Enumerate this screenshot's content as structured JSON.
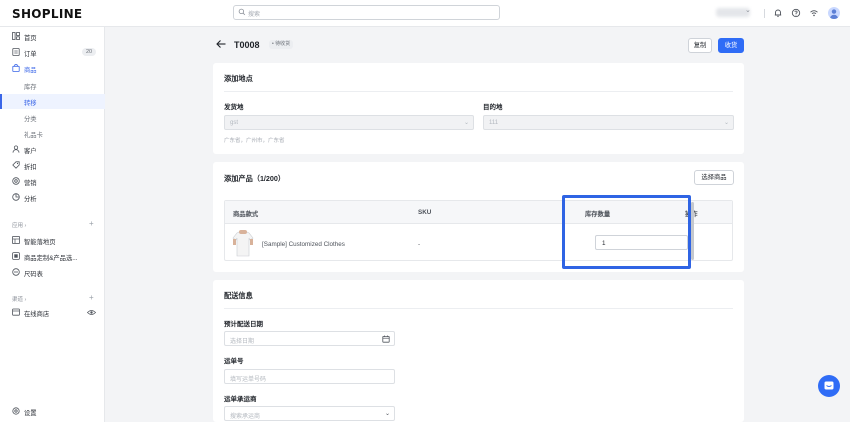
{
  "topbar": {
    "logo": "SHOPLINE",
    "search_placeholder": "搜索"
  },
  "sidebar": {
    "items": [
      {
        "label": "首页"
      },
      {
        "label": "订单",
        "badge": "20"
      },
      {
        "label": "商品"
      },
      {
        "label": "库存"
      },
      {
        "label": "转移"
      },
      {
        "label": "分类"
      },
      {
        "label": "礼品卡"
      },
      {
        "label": "客户"
      },
      {
        "label": "折扣"
      },
      {
        "label": "营销"
      },
      {
        "label": "分析"
      }
    ],
    "apps_section": "应用",
    "apps": [
      {
        "label": "智能落地页"
      },
      {
        "label": "商品定制&产品选..."
      },
      {
        "label": "尺码表"
      }
    ],
    "channels_section": "渠道",
    "channels": [
      {
        "label": "在线商店"
      }
    ],
    "settings_label": "设置"
  },
  "header": {
    "title": "T0008",
    "status": "• 待收货",
    "copy_button": "复制",
    "receive_button": "收货"
  },
  "location_card": {
    "title": "添加地点",
    "origin_label": "发货地",
    "origin_value": "gst",
    "origin_hint": "广东省，广州市，广东省",
    "destination_label": "目的地",
    "destination_value": "111"
  },
  "products_card": {
    "title": "添加产品（1/200）",
    "choose_button": "选择商品",
    "columns": [
      "商品款式",
      "SKU",
      "库存数量",
      "操作"
    ],
    "rows": [
      {
        "name": "[Sample] Customized Clothes",
        "sku": "-",
        "qty": "1"
      }
    ]
  },
  "delivery_card": {
    "title": "配送信息",
    "date_label": "预计配送日期",
    "date_placeholder": "选择日期",
    "tracking_label": "运单号",
    "tracking_placeholder": "填写运单号码",
    "carrier_label": "运单承运商",
    "carrier_placeholder": "搜索承运商"
  },
  "colors": {
    "primary": "#2f6cf6",
    "highlight": "#2f64e4"
  }
}
